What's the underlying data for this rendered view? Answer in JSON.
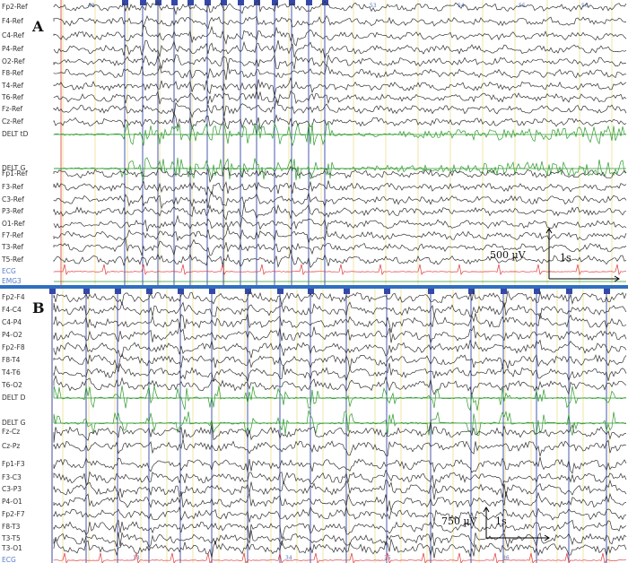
{
  "panelA": {
    "letter": "A",
    "channels": [
      "Fp2-Ref",
      "F4-Ref",
      "C4-Ref",
      "P4-Ref",
      "O2-Ref",
      "F8-Ref",
      "T4-Ref",
      "T6-Ref",
      "Fz-Ref",
      "Cz-Ref",
      "DELT tD",
      "DELT G",
      "Fp1-Ref",
      "F3-Ref",
      "C3-Ref",
      "P3-Ref",
      "O1-Ref",
      "F7-Ref",
      "T3-Ref",
      "T5-Ref",
      "ECG",
      "EMG3"
    ],
    "time_marks": [
      "48",
      "53",
      "54",
      "55",
      "56"
    ],
    "scale_amplitude": "500 µV",
    "scale_time": "1s"
  },
  "panelB": {
    "letter": "B",
    "channels": [
      "Fp2-F4",
      "F4-C4",
      "C4-P4",
      "P4-O2",
      "Fp2-F8",
      "F8-T4",
      "T4-T6",
      "T6-O2",
      "DELT D",
      "DELT G",
      "Fz-Cz",
      "Cz-Pz",
      "Fp1-F3",
      "F3-C3",
      "C3-P3",
      "P4-O1",
      "Fp2-F7",
      "F8-T3",
      "T3-T5",
      "T3-O1",
      "ECG"
    ],
    "time_marks": [
      "33",
      "34",
      "35",
      "36"
    ],
    "scale_amplitude": "750 µV",
    "scale_time": "1s"
  },
  "colors": {
    "eeg": "#333333",
    "emg": "#2e9a2e",
    "ecg": "#e03a3a",
    "marker": "#3548a8",
    "grid": "#e8d26a",
    "cursor": "#e03a3a"
  }
}
